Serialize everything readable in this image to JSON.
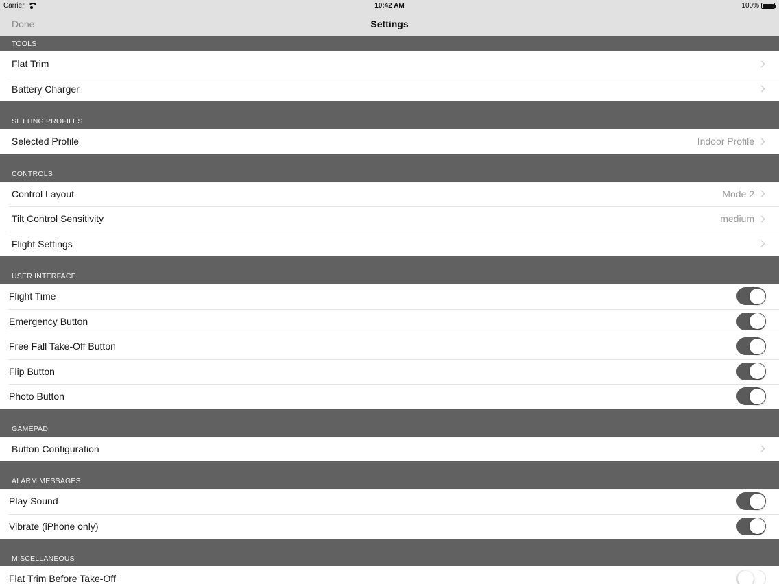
{
  "status_bar": {
    "carrier": "Carrier",
    "time": "10:42 AM",
    "battery": "100%"
  },
  "nav": {
    "done_label": "Done",
    "title": "Settings"
  },
  "sections": {
    "tools": {
      "header": "TOOLS",
      "rows": [
        {
          "label": "Flat Trim"
        },
        {
          "label": "Battery Charger"
        }
      ]
    },
    "setting_profiles": {
      "header": "SETTING PROFILES",
      "rows": [
        {
          "label": "Selected Profile",
          "value": "Indoor Profile"
        }
      ]
    },
    "controls": {
      "header": "CONTROLS",
      "rows": [
        {
          "label": "Control Layout",
          "value": "Mode 2"
        },
        {
          "label": "Tilt Control Sensitivity",
          "value": "medium"
        },
        {
          "label": "Flight Settings"
        }
      ]
    },
    "user_interface": {
      "header": "USER INTERFACE",
      "rows": [
        {
          "label": "Flight Time",
          "on": true
        },
        {
          "label": "Emergency Button",
          "on": true
        },
        {
          "label": "Free Fall Take-Off Button",
          "on": true
        },
        {
          "label": "Flip Button",
          "on": true
        },
        {
          "label": "Photo Button",
          "on": true
        }
      ]
    },
    "gamepad": {
      "header": "GAMEPAD",
      "rows": [
        {
          "label": "Button Configuration"
        }
      ]
    },
    "alarm_messages": {
      "header": "ALARM MESSAGES",
      "rows": [
        {
          "label": "Play Sound",
          "on": true
        },
        {
          "label": "Vibrate (iPhone only)",
          "on": true
        }
      ]
    },
    "miscellaneous": {
      "header": "MISCELLANEOUS",
      "rows": [
        {
          "label": "Flat Trim Before Take-Off",
          "on": false
        }
      ]
    }
  }
}
